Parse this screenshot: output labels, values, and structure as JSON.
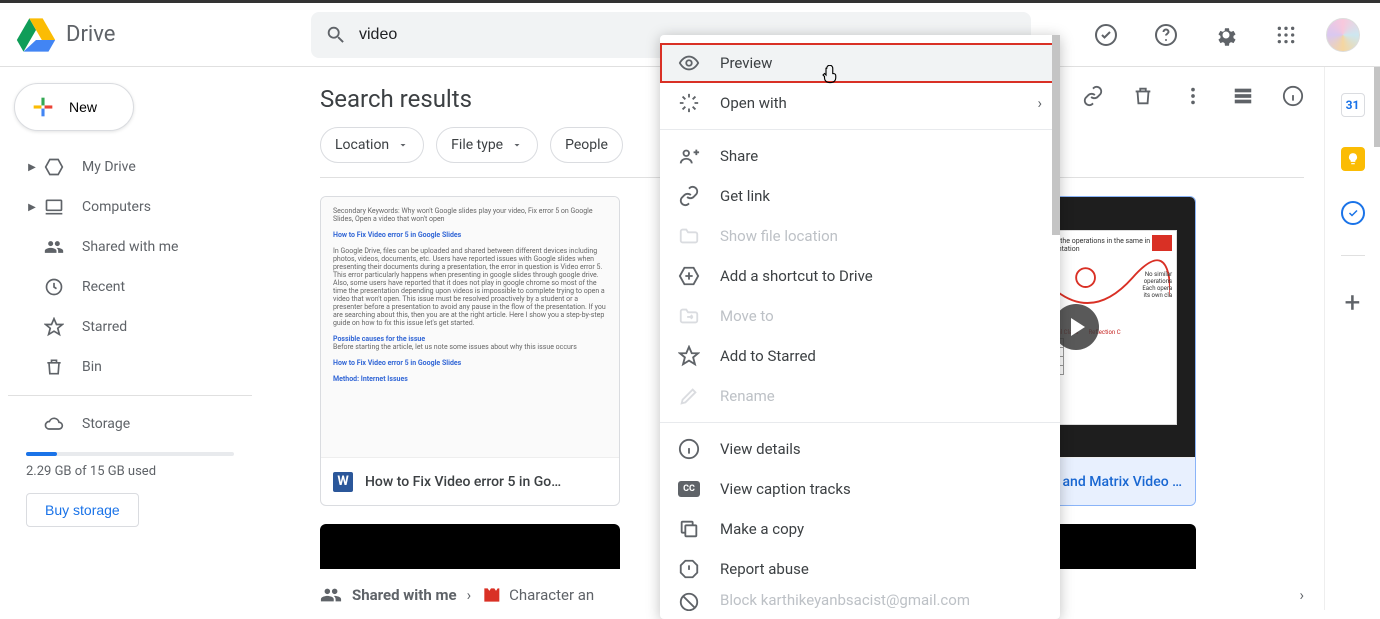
{
  "header": {
    "product": "Drive",
    "search_value": "video"
  },
  "sidebar": {
    "new_label": "New",
    "items": [
      "My Drive",
      "Computers",
      "Shared with me",
      "Recent",
      "Starred",
      "Bin"
    ],
    "storage_label": "Storage",
    "storage_used": "2.29 GB of 15 GB used",
    "buy_label": "Buy storage"
  },
  "content": {
    "title": "Search results",
    "chips": [
      "Location",
      "File type",
      "People"
    ],
    "cards": [
      {
        "title": "How to Fix Video error 5 in Go…",
        "type": "doc"
      },
      {
        "title": "Character and Matrix Video 4.…",
        "type": "video",
        "selected": true
      }
    ],
    "breadcrumb": {
      "root": "Shared with me",
      "current": "Character an"
    }
  },
  "menu": {
    "items": [
      {
        "label": "Preview",
        "icon": "eye",
        "selected": true
      },
      {
        "label": "Open with",
        "icon": "open",
        "submenu": true
      },
      {
        "divider": true
      },
      {
        "label": "Share",
        "icon": "share"
      },
      {
        "label": "Get link",
        "icon": "link"
      },
      {
        "label": "Show file location",
        "icon": "folder",
        "disabled": true
      },
      {
        "label": "Add a shortcut to Drive",
        "icon": "shortcut"
      },
      {
        "label": "Move to",
        "icon": "move",
        "disabled": true
      },
      {
        "label": "Add to Starred",
        "icon": "star"
      },
      {
        "label": "Rename",
        "icon": "pencil",
        "disabled": true
      },
      {
        "divider": true
      },
      {
        "label": "View details",
        "icon": "info"
      },
      {
        "label": "View caption tracks",
        "icon": "cc"
      },
      {
        "label": "Make a copy",
        "icon": "copy"
      },
      {
        "label": "Report abuse",
        "icon": "report"
      },
      {
        "label": "Block karthikeyanbsacist@gmail.com",
        "icon": "block",
        "cutoff": true
      }
    ]
  },
  "sidepanel": {
    "calendar_day": "31"
  }
}
